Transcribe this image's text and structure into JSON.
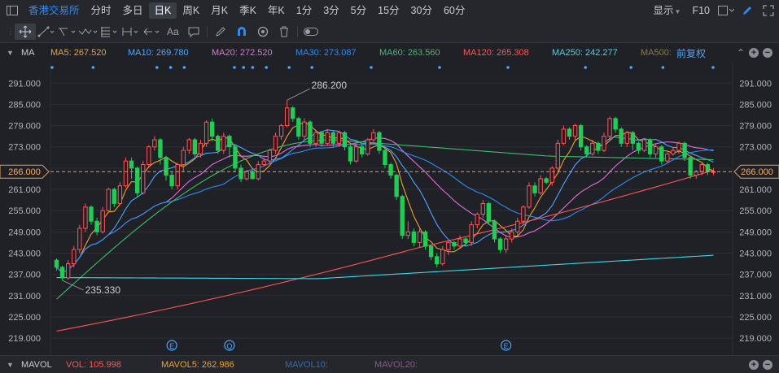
{
  "toolbar": {
    "exchange": "香港交易所",
    "periods": [
      {
        "label": "分时",
        "active": false
      },
      {
        "label": "多日",
        "active": false
      },
      {
        "label": "日K",
        "active": true
      },
      {
        "label": "周K",
        "active": false
      },
      {
        "label": "月K",
        "active": false
      },
      {
        "label": "季K",
        "active": false
      },
      {
        "label": "年K",
        "active": false
      },
      {
        "label": "1分",
        "active": false
      },
      {
        "label": "3分",
        "active": false
      },
      {
        "label": "5分",
        "active": false
      },
      {
        "label": "15分",
        "active": false
      },
      {
        "label": "30分",
        "active": false
      },
      {
        "label": "60分",
        "active": false
      }
    ],
    "display_label": "显示",
    "f10_label": "F10"
  },
  "drawing_tools": {
    "text_tool_label": "Aa"
  },
  "ma_bar": {
    "label": "MA",
    "items": [
      {
        "text": "MA5: 267.520",
        "color": "#f0a030"
      },
      {
        "text": "MA10: 269.780",
        "color": "#4da6ff"
      },
      {
        "text": "MA20: 272.520",
        "color": "#e070e0"
      },
      {
        "text": "MA30: 273.087",
        "color": "#2d8cf0"
      },
      {
        "text": "MA60: 263.560",
        "color": "#3cbf6a"
      },
      {
        "text": "MA120: 265.308",
        "color": "#ff5555"
      },
      {
        "text": "MA250: 242.277",
        "color": "#40d8e8"
      },
      {
        "text": "MA500:",
        "color": "#8a7a50"
      }
    ],
    "adjust_label": "前复权"
  },
  "chart_data": {
    "type": "candlestick",
    "y_ticks": [
      "291.000",
      "285.000",
      "279.000",
      "273.000",
      "267.000",
      "261.000",
      "255.000",
      "249.000",
      "243.000",
      "237.000",
      "231.000",
      "225.000",
      "219.000"
    ],
    "ylim": [
      216.5,
      294.5
    ],
    "current_price": "266.000",
    "high_annotation": "286.200",
    "low_annotation": "235.330",
    "event_markers": [
      "E",
      "Q",
      "E"
    ],
    "candles": [
      [
        241,
        239,
        241.5,
        238
      ],
      [
        239,
        236,
        239.5,
        235.3
      ],
      [
        236,
        240,
        241,
        235.5
      ],
      [
        240,
        244,
        245,
        239
      ],
      [
        244,
        250,
        251,
        243
      ],
      [
        250,
        256,
        257,
        249
      ],
      [
        256,
        252,
        256.5,
        251
      ],
      [
        252,
        249,
        253,
        248
      ],
      [
        249,
        255,
        256,
        248.5
      ],
      [
        255,
        261,
        261.5,
        254.5
      ],
      [
        261,
        257,
        261.5,
        256
      ],
      [
        257,
        262,
        263,
        256.5
      ],
      [
        262,
        269,
        270,
        261.5
      ],
      [
        269,
        267,
        270,
        264
      ],
      [
        267,
        260,
        267.5,
        259
      ],
      [
        260,
        268,
        269,
        259.5
      ],
      [
        268,
        273,
        273.5,
        267
      ],
      [
        273,
        275,
        276,
        272
      ],
      [
        275,
        270,
        275.5,
        268
      ],
      [
        270,
        265,
        270.5,
        263.5
      ],
      [
        265,
        262,
        266,
        261
      ],
      [
        262,
        268,
        268.5,
        261
      ],
      [
        268,
        272,
        273,
        266
      ],
      [
        272,
        275,
        275.5,
        271
      ],
      [
        275,
        271,
        275.5,
        270
      ],
      [
        271,
        274,
        275,
        270
      ],
      [
        274,
        280,
        280.5,
        273
      ],
      [
        280,
        276,
        281,
        274.5
      ],
      [
        276,
        272,
        276.5,
        271
      ],
      [
        272,
        276,
        277,
        271
      ],
      [
        276,
        273,
        276.5,
        270
      ],
      [
        273,
        267,
        273.5,
        266
      ],
      [
        267,
        264,
        268,
        263
      ],
      [
        264,
        266,
        266.5,
        263.5
      ],
      [
        266,
        264,
        266.5,
        264
      ],
      [
        264,
        268,
        269,
        263.5
      ],
      [
        268,
        269,
        270,
        267.5
      ],
      [
        269,
        272,
        272.5,
        268
      ],
      [
        272,
        276,
        277,
        271
      ],
      [
        276,
        279,
        279.5,
        275
      ],
      [
        279,
        284,
        286.2,
        278.5
      ],
      [
        284,
        281,
        284.5,
        280
      ],
      [
        281,
        276,
        281.5,
        275
      ],
      [
        276,
        280,
        281,
        275
      ],
      [
        280,
        274,
        280.5,
        273
      ],
      [
        274,
        277,
        277.5,
        273
      ],
      [
        277,
        274,
        277.5,
        273
      ],
      [
        274,
        277,
        278,
        273.5
      ],
      [
        277,
        274,
        277.5,
        273
      ],
      [
        274,
        277,
        277.5,
        273
      ],
      [
        277,
        273,
        277.5,
        272
      ],
      [
        273,
        269,
        273.5,
        268
      ],
      [
        269,
        273,
        274,
        268.5
      ],
      [
        273,
        271,
        274,
        270
      ],
      [
        271,
        275,
        275.5,
        270.5
      ],
      [
        275,
        277,
        278,
        274
      ],
      [
        277,
        272,
        277.5,
        271
      ],
      [
        272,
        268,
        272.5,
        267
      ],
      [
        268,
        265,
        268.5,
        264
      ],
      [
        265,
        259,
        265.5,
        258
      ],
      [
        259,
        248,
        259.5,
        247
      ],
      [
        248,
        249,
        252,
        247
      ],
      [
        249,
        246,
        250,
        245
      ],
      [
        246,
        249,
        250,
        244.5
      ],
      [
        249,
        245,
        249.5,
        244
      ],
      [
        245,
        242,
        245.5,
        241
      ],
      [
        242,
        240,
        243,
        239
      ],
      [
        240,
        244,
        245,
        239.5
      ],
      [
        244,
        246,
        246.5,
        242.5
      ],
      [
        246,
        245,
        246.5,
        244
      ],
      [
        245,
        247,
        248,
        244.5
      ],
      [
        247,
        246,
        247.5,
        245
      ],
      [
        246,
        251,
        252,
        245
      ],
      [
        251,
        254,
        254.5,
        250
      ],
      [
        254,
        257,
        258,
        253
      ],
      [
        257,
        252,
        257.5,
        251
      ],
      [
        252,
        247,
        252.5,
        246
      ],
      [
        247,
        244,
        247.5,
        243
      ],
      [
        244,
        247,
        248,
        243
      ],
      [
        247,
        249,
        250,
        246
      ],
      [
        249,
        252,
        253,
        248
      ],
      [
        252,
        256,
        256.5,
        251
      ],
      [
        256,
        262,
        263,
        255.5
      ],
      [
        262,
        260,
        263,
        259
      ],
      [
        260,
        264,
        265,
        259.5
      ],
      [
        264,
        263,
        264.5,
        262.5
      ],
      [
        263,
        267,
        267.5,
        262
      ],
      [
        267,
        274,
        275,
        266
      ],
      [
        274,
        278,
        279,
        273.5
      ],
      [
        278,
        276,
        278.5,
        275
      ],
      [
        276,
        279,
        279.5,
        275
      ],
      [
        279,
        273,
        279.5,
        272
      ],
      [
        273,
        271,
        273.5,
        270
      ],
      [
        271,
        274,
        275,
        270.5
      ],
      [
        274,
        272,
        274.5,
        271
      ],
      [
        272,
        276,
        277,
        271.5
      ],
      [
        276,
        281,
        281.5,
        275
      ],
      [
        281,
        278,
        281.5,
        277
      ],
      [
        278,
        274,
        278.5,
        273
      ],
      [
        274,
        277,
        277.5,
        273
      ],
      [
        277,
        274,
        277.5,
        272
      ],
      [
        274,
        272,
        274.5,
        271
      ],
      [
        272,
        275,
        275.5,
        271.5
      ],
      [
        275,
        271,
        275.5,
        270
      ],
      [
        271,
        273,
        274,
        270
      ],
      [
        273,
        269,
        273.5,
        268
      ],
      [
        269,
        271,
        271.5,
        268.5
      ],
      [
        271,
        272,
        273,
        270.5
      ],
      [
        272,
        274,
        274.5,
        271
      ],
      [
        274,
        270,
        274.5,
        269
      ],
      [
        270,
        265,
        270.5,
        264
      ],
      [
        265,
        266,
        266.5,
        264
      ],
      [
        266,
        268,
        268.5,
        265
      ],
      [
        268,
        266,
        268.5,
        265
      ],
      [
        266,
        266,
        267,
        265
      ]
    ]
  },
  "volume_bar": {
    "label": "MAVOL",
    "items": [
      {
        "text": "VOL: 105.998",
        "color": "#ff5555"
      },
      {
        "text": "MAVOL5: 262.986",
        "color": "#f0a030"
      },
      {
        "text": "MAVOL10:",
        "color": "#2d6fb0"
      },
      {
        "text": "MAVOL20:",
        "color": "#8a5a8a"
      }
    ]
  }
}
